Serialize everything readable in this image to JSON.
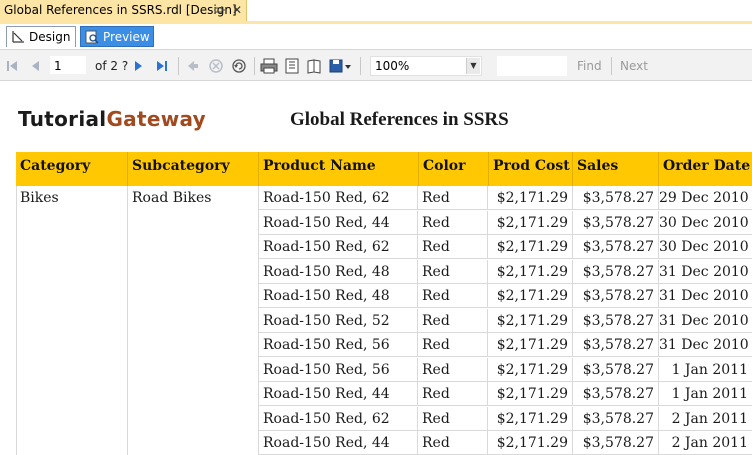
{
  "document_tab": {
    "title": "Global References in SSRS.rdl [Design]",
    "pin_icon": "pin-icon",
    "close_icon": "close-icon",
    "close_glyph": "✕"
  },
  "view_tabs": [
    {
      "label": "Design",
      "icon": "design-icon"
    },
    {
      "label": "Preview",
      "icon": "preview-icon"
    }
  ],
  "toolbar": {
    "page_value": "1",
    "page_of": "of  2 ?",
    "zoom_value": "100%",
    "find_label": "Find",
    "next_label": "Next",
    "icons": [
      "first-page-icon",
      "previous-page-icon",
      "next-page-icon",
      "last-page-icon",
      "back-icon",
      "stop-icon",
      "refresh-icon",
      "print-icon",
      "print-layout-icon",
      "page-setup-icon",
      "export-icon"
    ]
  },
  "report": {
    "logo_part1": "Tutorial",
    "logo_part2": "Gateway",
    "title": "Global References in SSRS",
    "header_color": "#ffc800",
    "columns": [
      "Category",
      "Subcategory",
      "Product Name",
      "Color",
      "Prod Cost",
      "Sales",
      "Order Date"
    ],
    "category": "Bikes",
    "subcategory": "Road Bikes",
    "rows": [
      {
        "product": "Road-150 Red, 62",
        "color": "Red",
        "cost": "$2,171.29",
        "sales": "$3,578.27",
        "date": "29 Dec 2010"
      },
      {
        "product": "Road-150 Red, 44",
        "color": "Red",
        "cost": "$2,171.29",
        "sales": "$3,578.27",
        "date": "30 Dec 2010"
      },
      {
        "product": "Road-150 Red, 62",
        "color": "Red",
        "cost": "$2,171.29",
        "sales": "$3,578.27",
        "date": "30 Dec 2010"
      },
      {
        "product": "Road-150 Red, 48",
        "color": "Red",
        "cost": "$2,171.29",
        "sales": "$3,578.27",
        "date": "31 Dec 2010"
      },
      {
        "product": "Road-150 Red, 48",
        "color": "Red",
        "cost": "$2,171.29",
        "sales": "$3,578.27",
        "date": "31 Dec 2010"
      },
      {
        "product": "Road-150 Red, 52",
        "color": "Red",
        "cost": "$2,171.29",
        "sales": "$3,578.27",
        "date": "31 Dec 2010"
      },
      {
        "product": "Road-150 Red, 56",
        "color": "Red",
        "cost": "$2,171.29",
        "sales": "$3,578.27",
        "date": "31 Dec 2010"
      },
      {
        "product": "Road-150 Red, 56",
        "color": "Red",
        "cost": "$2,171.29",
        "sales": "$3,578.27",
        "date": "1 Jan 2011"
      },
      {
        "product": "Road-150 Red, 44",
        "color": "Red",
        "cost": "$2,171.29",
        "sales": "$3,578.27",
        "date": "1 Jan 2011"
      },
      {
        "product": "Road-150 Red, 62",
        "color": "Red",
        "cost": "$2,171.29",
        "sales": "$3,578.27",
        "date": "2 Jan 2011"
      },
      {
        "product": "Road-150 Red, 44",
        "color": "Red",
        "cost": "$2,171.29",
        "sales": "$3,578.27",
        "date": "2 Jan 2011"
      }
    ]
  }
}
